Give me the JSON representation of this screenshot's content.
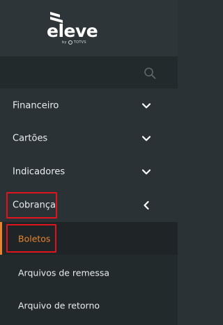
{
  "brand": {
    "logo_text": "eleve",
    "tagline_prefix": "by",
    "tagline_brand": "TOTVS"
  },
  "search": {
    "icon": "search-icon"
  },
  "menu": {
    "items": [
      {
        "label": "Financeiro",
        "icon": "chevron-down-icon",
        "expanded": false
      },
      {
        "label": "Cartões",
        "icon": "chevron-down-icon",
        "expanded": false
      },
      {
        "label": "Indicadores",
        "icon": "chevron-down-icon",
        "expanded": false
      },
      {
        "label": "Cobrança",
        "icon": "chevron-left-icon",
        "expanded": true
      }
    ],
    "submenu": [
      {
        "label": "Boletos",
        "active": true
      },
      {
        "label": "Arquivos de remessa",
        "active": false
      },
      {
        "label": "Arquivo de retorno",
        "active": false
      }
    ]
  },
  "colors": {
    "sidebar_bg": "#2b3235",
    "active_accent": "#e8842c",
    "highlight_box": "#e0141c"
  }
}
